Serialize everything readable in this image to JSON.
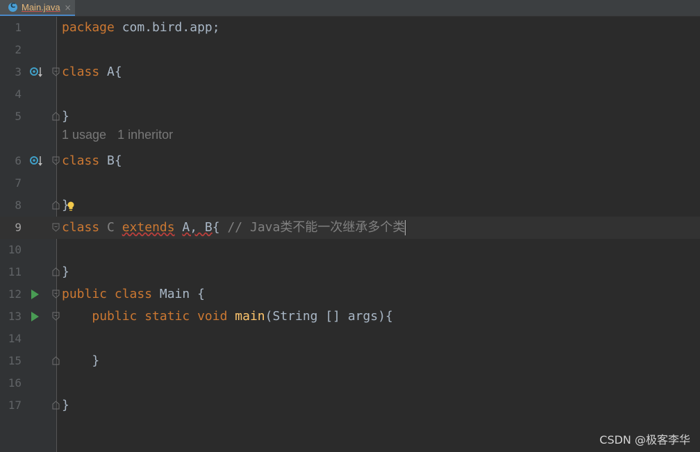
{
  "tab": {
    "label": "Main.java",
    "close": "×"
  },
  "hint": {
    "usages": "1 usage",
    "inheritors": "1 inheritor"
  },
  "lines": {
    "l1": {
      "num": "1",
      "kw": "package",
      "rest": " com.bird.app;"
    },
    "l2": {
      "num": "2"
    },
    "l3": {
      "num": "3",
      "kw": "class",
      "rest": " A{"
    },
    "l4": {
      "num": "4"
    },
    "l5": {
      "num": "5",
      "rest": "}"
    },
    "l6": {
      "num": "6",
      "kw": "class",
      "rest": " B{"
    },
    "l7": {
      "num": "7"
    },
    "l8": {
      "num": "8",
      "rest": "}"
    },
    "l9": {
      "num": "9",
      "kw": "class",
      "name": "C",
      "kw2": "extends",
      "parents": "A, B",
      "brace": "{",
      "comment": "// Java类不能一次继承多个类"
    },
    "l10": {
      "num": "10"
    },
    "l11": {
      "num": "11",
      "rest": "}"
    },
    "l12": {
      "num": "12",
      "kw": "public class",
      "rest": " Main {"
    },
    "l13": {
      "num": "13",
      "indent": "    ",
      "kw": "public static void",
      "fn": "main",
      "rest": "(String [] args){"
    },
    "l14": {
      "num": "14"
    },
    "l15": {
      "num": "15",
      "rest": "    }"
    },
    "l16": {
      "num": "16"
    },
    "l17": {
      "num": "17",
      "rest": "}"
    }
  },
  "watermark": "CSDN @极客李华",
  "colors": {
    "keyword": "#cc7832",
    "function": "#ffc66d",
    "comment": "#808080",
    "text": "#a9b7c6",
    "background": "#2b2b2b",
    "gutter": "#313335"
  }
}
